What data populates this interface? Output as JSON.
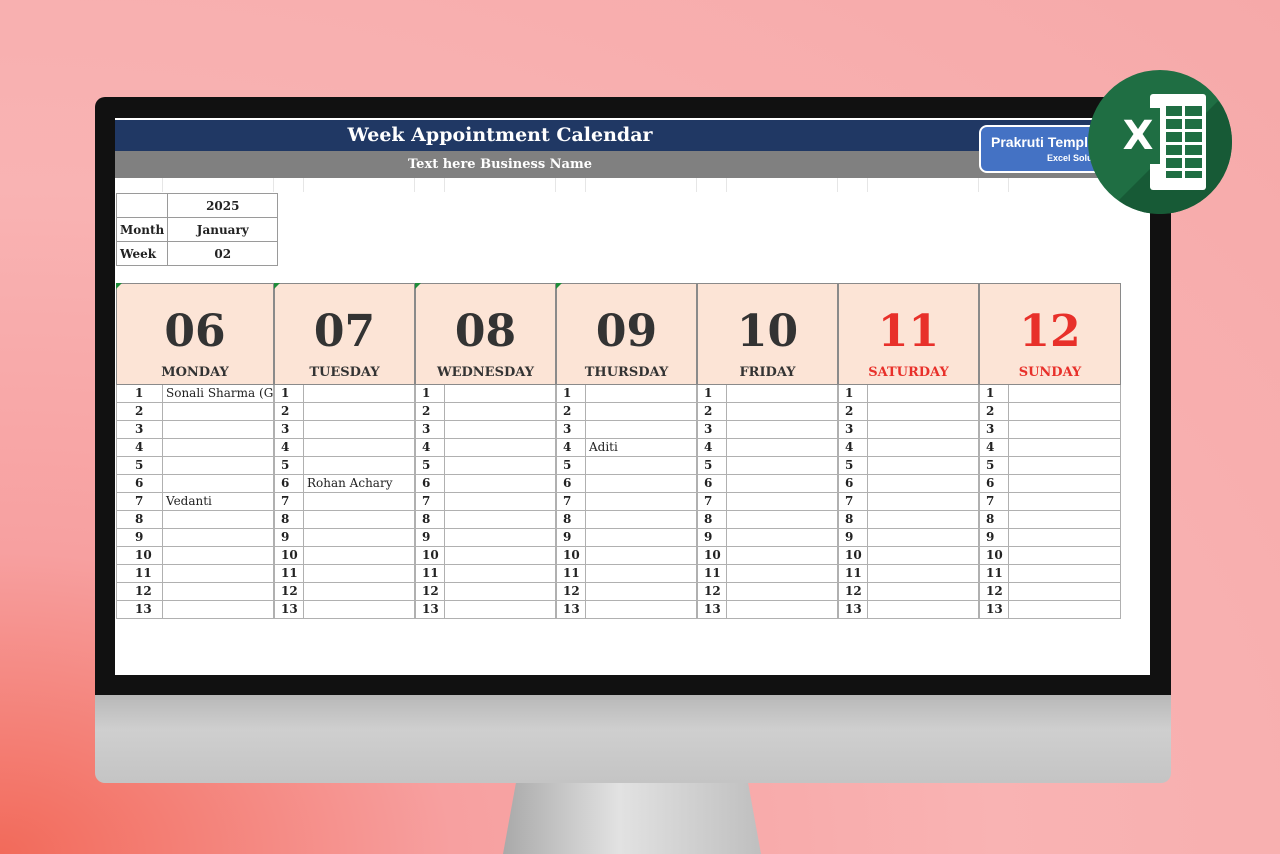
{
  "header": {
    "title": "Week Appointment Calendar",
    "subtitle": "Text here Business Name",
    "brand_name": "Prakruti Templa",
    "brand_tag": "Excel Solut"
  },
  "info": {
    "year": "2025",
    "month_label": "Month",
    "month": "January",
    "week_label": "Week",
    "week": "02"
  },
  "days": [
    {
      "num": "06",
      "name": "MONDAY",
      "weekend": false,
      "flag": true
    },
    {
      "num": "07",
      "name": "TUESDAY",
      "weekend": false,
      "flag": true
    },
    {
      "num": "08",
      "name": "WEDNESDAY",
      "weekend": false,
      "flag": true
    },
    {
      "num": "09",
      "name": "THURSDAY",
      "weekend": false,
      "flag": true
    },
    {
      "num": "10",
      "name": "FRIDAY",
      "weekend": false,
      "flag": false
    },
    {
      "num": "11",
      "name": "SATURDAY",
      "weekend": true,
      "flag": false
    },
    {
      "num": "12",
      "name": "SUNDAY",
      "weekend": true,
      "flag": false
    }
  ],
  "slot_numbers": [
    "1",
    "2",
    "3",
    "4",
    "5",
    "6",
    "7",
    "8",
    "9",
    "10",
    "11",
    "12",
    "13"
  ],
  "appointments": [
    [
      "Sonali Sharma (GM)",
      "",
      "",
      "",
      "",
      "",
      "Vedanti",
      "",
      "",
      "",
      "",
      "",
      ""
    ],
    [
      "",
      "",
      "",
      "",
      "",
      "Rohan Achary",
      "",
      "",
      "",
      "",
      "",
      "",
      ""
    ],
    [
      "",
      "",
      "",
      "",
      "",
      "",
      "",
      "",
      "",
      "",
      "",
      "",
      ""
    ],
    [
      "",
      "",
      "",
      "Aditi",
      "",
      "",
      "",
      "",
      "",
      "",
      "",
      "",
      ""
    ],
    [
      "",
      "",
      "",
      "",
      "",
      "",
      "",
      "",
      "",
      "",
      "",
      "",
      ""
    ],
    [
      "",
      "",
      "",
      "",
      "",
      "",
      "",
      "",
      "",
      "",
      "",
      "",
      ""
    ],
    [
      "",
      "",
      "",
      "",
      "",
      "",
      "",
      "",
      "",
      "",
      "",
      "",
      ""
    ]
  ],
  "colors": {
    "title_bar": "#203864",
    "sub_bar": "#808080",
    "day_header_bg": "#fce4d6",
    "weekend_text": "#e8302a",
    "excel_green": "#1f6e43",
    "brand_blue": "#4472c4"
  },
  "icons": {
    "excel": "excel-logo-icon"
  },
  "excel_logo_letter": "X"
}
